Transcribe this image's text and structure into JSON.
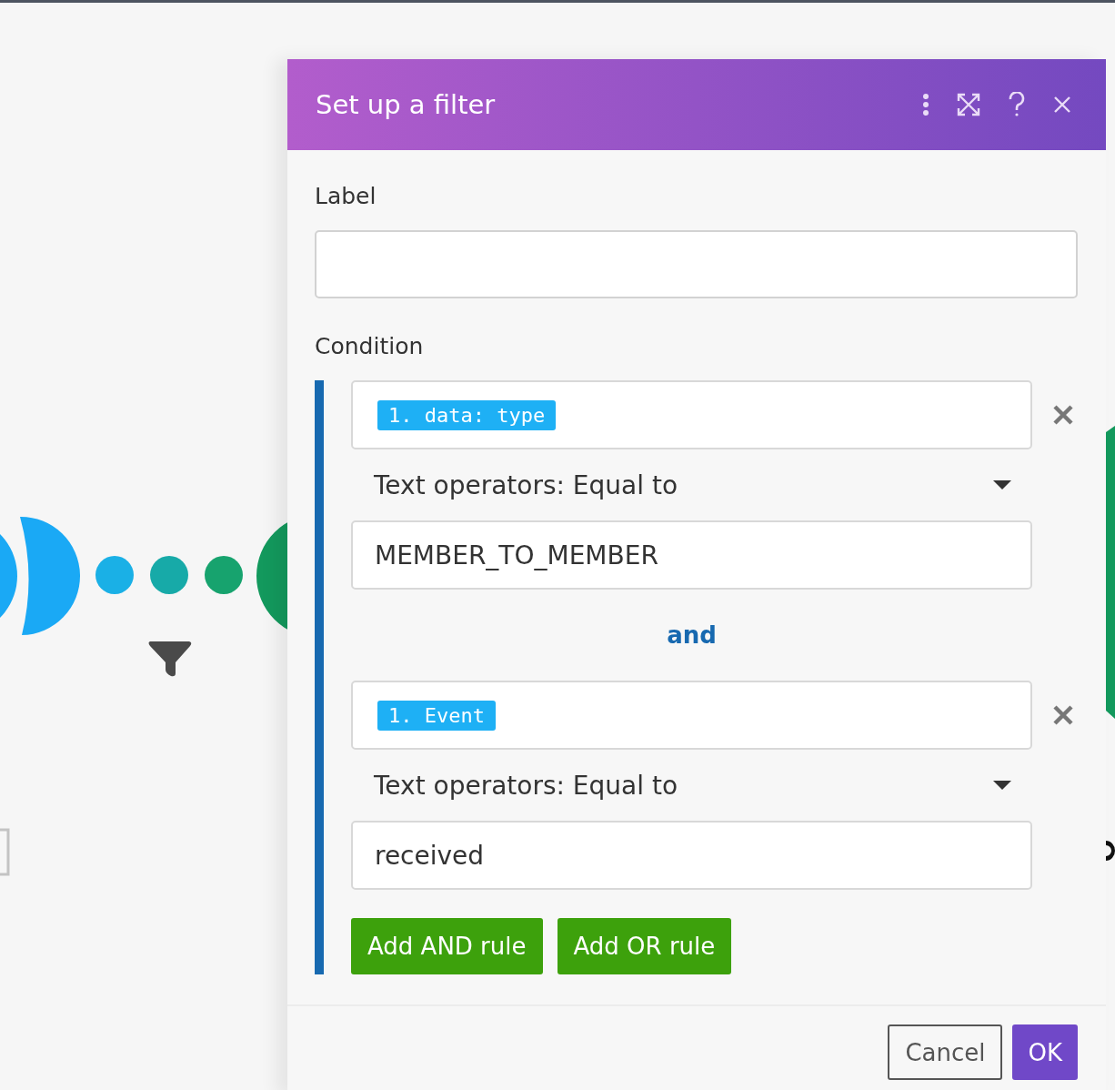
{
  "dialog": {
    "title": "Set up a filter"
  },
  "label_field": {
    "label": "Label"
  },
  "condition": {
    "label": "Condition",
    "rules": [
      {
        "token": "1. data: type",
        "operator": "Text operators: Equal to",
        "value": "MEMBER_TO_MEMBER"
      },
      {
        "token": "1. Event",
        "operator": "Text operators: Equal to",
        "value": "received"
      }
    ],
    "connector": "and",
    "buttons": [
      "Add AND rule",
      "Add OR rule"
    ]
  },
  "footer": {
    "buttons": [
      {
        "label": "Cancel",
        "kind": "secondary"
      },
      {
        "label": "OK",
        "kind": "primary"
      }
    ]
  }
}
